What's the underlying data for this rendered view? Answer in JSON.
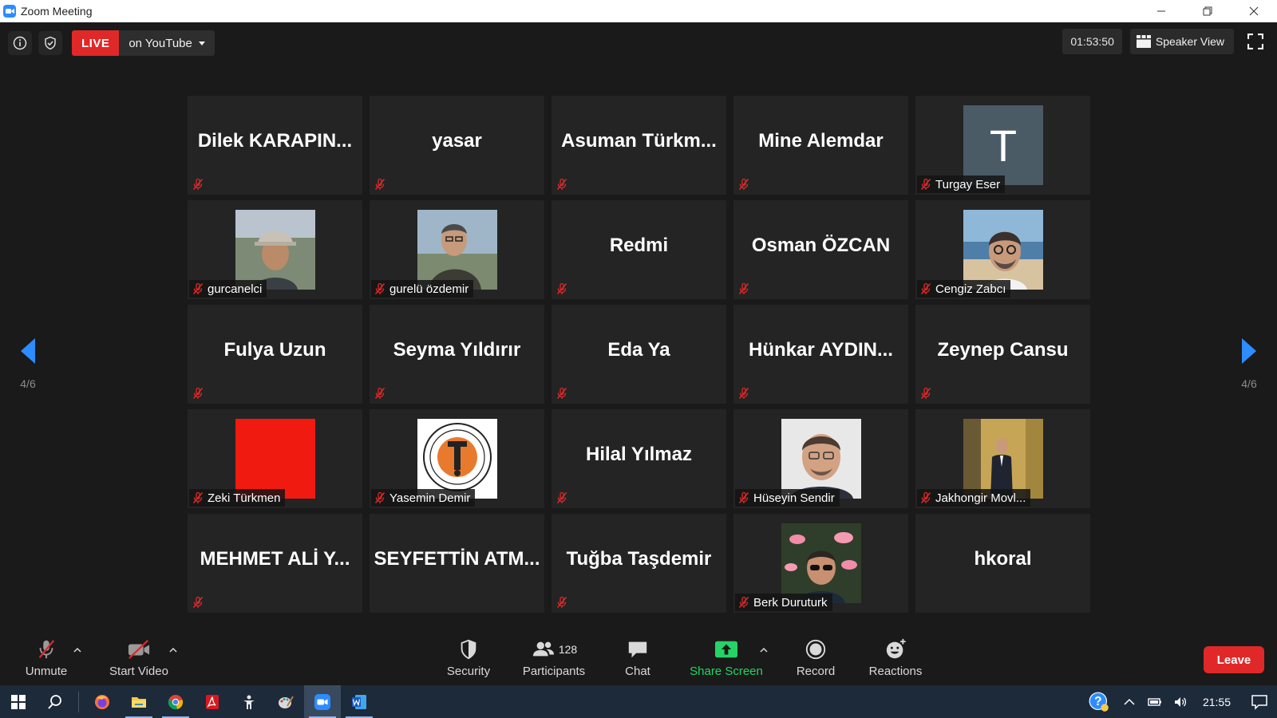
{
  "window": {
    "title": "Zoom Meeting"
  },
  "top_bar": {
    "live_badge": "LIVE",
    "live_target": "on YouTube",
    "timer": "01:53:50",
    "speaker_view_label": "Speaker View"
  },
  "pager": {
    "page_label": "4/6"
  },
  "participants": [
    {
      "name": "Dilek  KARAPIN...",
      "display": "name",
      "muted": true
    },
    {
      "name": "yasar",
      "display": "name",
      "muted": true
    },
    {
      "name": "Asuman  Türkm...",
      "display": "name",
      "muted": true
    },
    {
      "name": "Mine Alemdar",
      "display": "name",
      "muted": true
    },
    {
      "name": "Turgay Eser",
      "display": "avatar",
      "avatar": "letter-t",
      "avatar_letter": "T",
      "muted": true
    },
    {
      "name": "gurcanelci",
      "display": "avatar",
      "avatar": "photo-hat",
      "muted": true
    },
    {
      "name": "gurelü özdemir",
      "display": "avatar",
      "avatar": "photo-man-glasses",
      "muted": true
    },
    {
      "name": "Redmi",
      "display": "name",
      "muted": true
    },
    {
      "name": "Osman ÖZCAN",
      "display": "name",
      "muted": true
    },
    {
      "name": "Cengiz Zabcı",
      "display": "avatar",
      "avatar": "photo-beach",
      "muted": true
    },
    {
      "name": "Fulya Uzun",
      "display": "name",
      "muted": true
    },
    {
      "name": "Seyma Yıldırır",
      "display": "name",
      "muted": true
    },
    {
      "name": "Eda Ya",
      "display": "name",
      "muted": true
    },
    {
      "name": "Hünkar  AYDIN...",
      "display": "name",
      "muted": true
    },
    {
      "name": "Zeynep Cansu",
      "display": "name",
      "muted": true
    },
    {
      "name": "Zeki Türkmen",
      "display": "avatar",
      "avatar": "red-square",
      "muted": true
    },
    {
      "name": "Yasemin Demir",
      "display": "avatar",
      "avatar": "logo-seal",
      "muted": true
    },
    {
      "name": "Hilal Yılmaz",
      "display": "name",
      "muted": true
    },
    {
      "name": "Hüseyin Sendir",
      "display": "avatar",
      "avatar": "photo-portrait",
      "muted": true
    },
    {
      "name": "Jakhongir Movl...",
      "display": "avatar",
      "avatar": "photo-suit",
      "muted": true
    },
    {
      "name": "MEHMET ALİ Y...",
      "display": "name",
      "muted": true
    },
    {
      "name": "SEYFETTİN  ATM...",
      "display": "name",
      "muted": false
    },
    {
      "name": "Tuğba Taşdemir",
      "display": "name",
      "muted": true
    },
    {
      "name": "Berk Duruturk",
      "display": "avatar",
      "avatar": "photo-flamingo",
      "muted": true
    },
    {
      "name": "hkoral",
      "display": "name",
      "muted": false
    }
  ],
  "toolbar": {
    "unmute_label": "Unmute",
    "start_video_label": "Start Video",
    "security_label": "Security",
    "participants_label": "Participants",
    "participants_count": "128",
    "chat_label": "Chat",
    "share_screen_label": "Share Screen",
    "record_label": "Record",
    "reactions_label": "Reactions",
    "leave_label": "Leave"
  },
  "taskbar": {
    "clock": "21:55",
    "apps": [
      "start-icon",
      "search-icon",
      "firefox-icon",
      "file-explorer-icon",
      "chrome-icon",
      "acrobat-icon",
      "app-icon",
      "paint-icon",
      "zoom-icon",
      "word-icon"
    ]
  },
  "colors": {
    "accent_blue": "#2d8cff",
    "live_red": "#e02828",
    "share_green": "#25d366",
    "mute_red": "#e02828",
    "tile_bg": "#242424"
  }
}
